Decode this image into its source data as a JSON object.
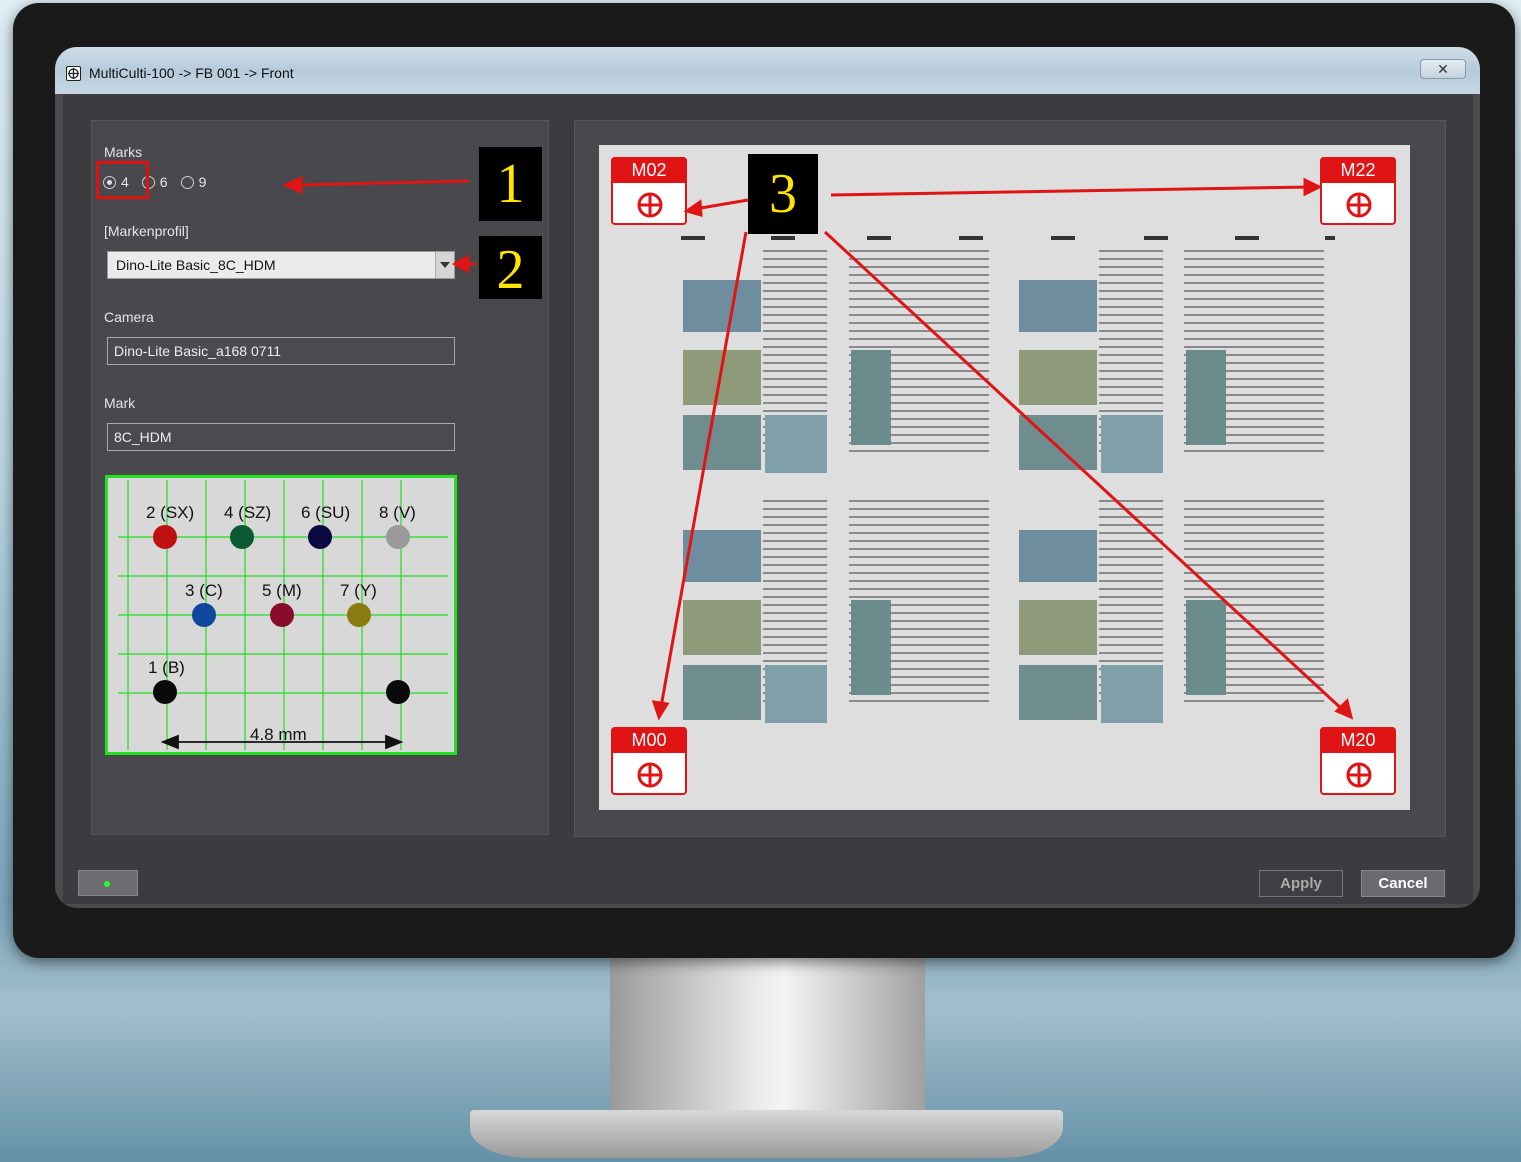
{
  "window": {
    "title": "MultiCulti-100 -> FB 001 -> Front",
    "close_label": "✕"
  },
  "marks": {
    "label": "Marks",
    "options": [
      "4",
      "6",
      "9"
    ],
    "selected": "4"
  },
  "profile": {
    "label": "[Markenprofil]",
    "value": "Dino-Lite Basic_8C_HDM"
  },
  "camera": {
    "label": "Camera",
    "value": "Dino-Lite Basic_a168 0711"
  },
  "mark": {
    "label": "Mark",
    "value": "8C_HDM"
  },
  "mark_diagram": {
    "top_row": [
      "2 (SX)",
      "4 (SZ)",
      "6 (SU)",
      "8 (V)"
    ],
    "middle_row": [
      "3 (C)",
      "5 (M)",
      "7 (Y)"
    ],
    "bottom_label": "1 (B)",
    "dimension": "4.8 mm",
    "colors": {
      "sx": "#c01010",
      "sz": "#0c5a32",
      "su": "#0a0a40",
      "v": "#9a9a9a",
      "c": "#1048a0",
      "m": "#8a0c2c",
      "y": "#8a7a10",
      "b": "#0a0a0a"
    }
  },
  "annotations": {
    "a1": "1",
    "a2": "2",
    "a3": "3"
  },
  "corner_marks": {
    "top_left": "M02",
    "top_right": "M22",
    "bottom_left": "M00",
    "bottom_right": "M20"
  },
  "buttons": {
    "apply": "Apply",
    "cancel": "Cancel"
  },
  "accent": {
    "highlight": "#e01010",
    "annotation_text": "#ffe400",
    "mark_box_border": "#22e022"
  }
}
